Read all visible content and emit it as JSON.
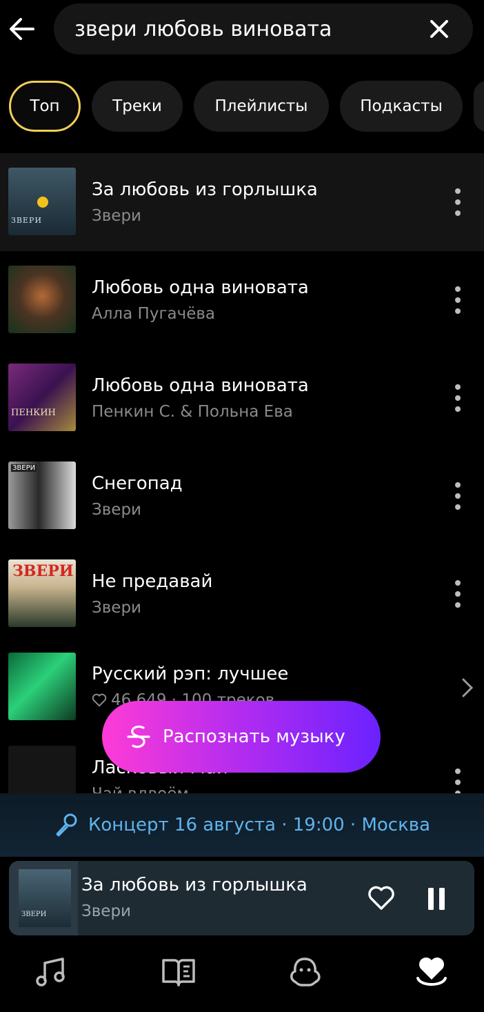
{
  "search": {
    "query": "звери любовь виновата"
  },
  "filters": {
    "chips": [
      {
        "label": "Топ",
        "active": true
      },
      {
        "label": "Треки",
        "active": false
      },
      {
        "label": "Плейлисты",
        "active": false
      },
      {
        "label": "Подкасты",
        "active": false
      }
    ]
  },
  "results": [
    {
      "title": "За любовь из горлышка",
      "subtitle": "Звери",
      "cover_text": "ЗВЕРИ"
    },
    {
      "title": "Любовь одна виновата",
      "subtitle": "Алла Пугачёва"
    },
    {
      "title": "Любовь одна виновата",
      "subtitle": "Пенкин С. & Польна Ева",
      "cover_text": "ПЕНКИН"
    },
    {
      "title": "Снегопад",
      "subtitle": "Звери",
      "cover_text": "ЗВЕРИ"
    },
    {
      "title": "Не предавай",
      "subtitle": "Звери",
      "cover_text": "ЗВЕРИ"
    },
    {
      "title": "Русский рэп: лучшее",
      "subtitle": "46 649 · 100 треков",
      "kind": "playlist"
    },
    {
      "title": "Ласковый Май",
      "subtitle": "Чай вдвоём"
    }
  ],
  "fab": {
    "label": "Распознать музыку"
  },
  "concert": {
    "text": "Концерт 16 августа · 19:00 · Москва"
  },
  "player": {
    "title": "За любовь из горлышка",
    "artist": "Звери",
    "cover_text": "ЗВЕРИ"
  },
  "colors": {
    "accent_chip_border": "#f2d058",
    "fab_gradient_start": "#ff3bd6",
    "fab_gradient_end": "#6a22ff",
    "concert_text": "#5fb4ee"
  },
  "icons": {
    "nav": [
      "music-note-icon",
      "book-icon",
      "kids-icon",
      "heart-collection-icon"
    ]
  }
}
